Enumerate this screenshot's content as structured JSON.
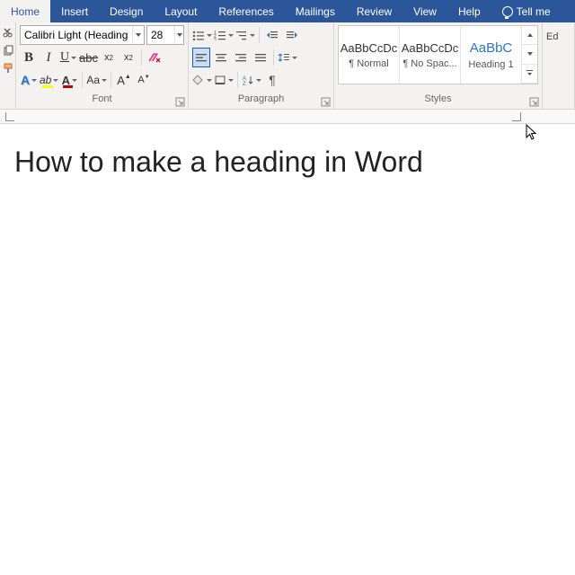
{
  "tabs": {
    "items": [
      "Home",
      "Insert",
      "Design",
      "Layout",
      "References",
      "Mailings",
      "Review",
      "View",
      "Help"
    ],
    "active": "Home",
    "tellme": "Tell me"
  },
  "font": {
    "name": "Calibri Light (Headings)",
    "size": "28",
    "group_label": "Font"
  },
  "paragraph": {
    "group_label": "Paragraph"
  },
  "styles": {
    "group_label": "Styles",
    "preview": "AaBbCcDc",
    "preview_h1": "AaBbC",
    "items": [
      {
        "label": "¶ Normal"
      },
      {
        "label": "¶ No Spac..."
      },
      {
        "label": "Heading 1"
      }
    ]
  },
  "editing": {
    "label": "Ed"
  },
  "document": {
    "heading": "How to make a heading in Word"
  },
  "colors": {
    "highlight": "#ffff00",
    "fontcolor": "#c00000",
    "shading": "#ffff00",
    "border": "#666666"
  }
}
